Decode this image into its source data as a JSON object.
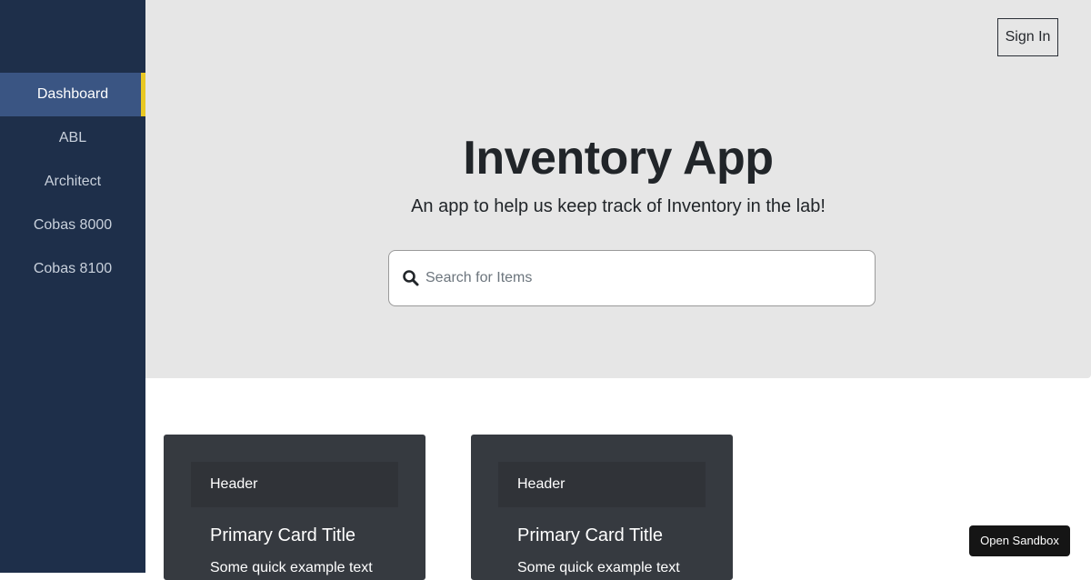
{
  "sidebar": {
    "items": [
      {
        "label": "Dashboard",
        "active": true
      },
      {
        "label": "ABL"
      },
      {
        "label": "Architect"
      },
      {
        "label": "Cobas 8000"
      },
      {
        "label": "Cobas 8100"
      }
    ],
    "colors": {
      "background": "#1e2f4a",
      "active": "#3a5583",
      "indicator": "#e9c823"
    }
  },
  "header": {
    "signin_label": "Sign In"
  },
  "hero": {
    "title": "Inventory App",
    "subtitle": "An app to help us keep track of Inventory in the lab!",
    "background": "#e6e6e6"
  },
  "search": {
    "placeholder": "Search for Items",
    "value": "",
    "icon": "search-icon"
  },
  "cards": [
    {
      "header": "Header",
      "title": "Primary Card Title",
      "text": "Some quick example text"
    },
    {
      "header": "Header",
      "title": "Primary Card Title",
      "text": "Some quick example text"
    }
  ],
  "sandbox_label": "Open Sandbox"
}
